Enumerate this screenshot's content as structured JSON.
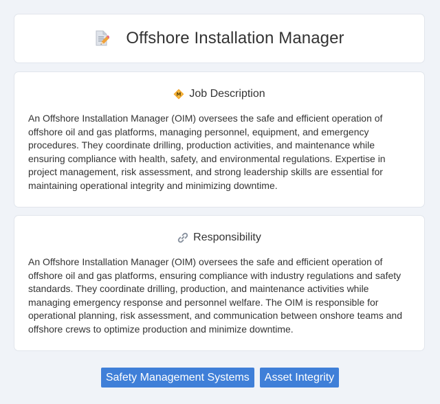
{
  "header": {
    "title": "Offshore Installation Manager",
    "icon": "document-pencil-icon"
  },
  "job_description": {
    "heading": "Job Description",
    "icon": "diamond-badge-icon",
    "text": "An Offshore Installation Manager (OIM) oversees the safe and efficient operation of offshore oil and gas platforms, managing personnel, equipment, and emergency procedures. They coordinate drilling, production activities, and maintenance while ensuring compliance with health, safety, and environmental regulations. Expertise in project management, risk assessment, and strong leadership skills are essential for maintaining operational integrity and minimizing downtime."
  },
  "responsibility": {
    "heading": "Responsibility",
    "icon": "link-icon",
    "text": "An Offshore Installation Manager (OIM) oversees the safe and efficient operation of offshore oil and gas platforms, ensuring compliance with industry regulations and safety standards. They coordinate drilling, production, and maintenance activities while managing emergency response and personnel welfare. The OIM is responsible for operational planning, risk assessment, and communication between onshore teams and offshore crews to optimize production and minimize downtime."
  },
  "tags": [
    {
      "label": "Safety Management Systems"
    },
    {
      "label": "Asset Integrity"
    }
  ],
  "colors": {
    "background": "#f0f3f8",
    "card": "#ffffff",
    "tag": "#3f7fd8",
    "text": "#333333"
  }
}
